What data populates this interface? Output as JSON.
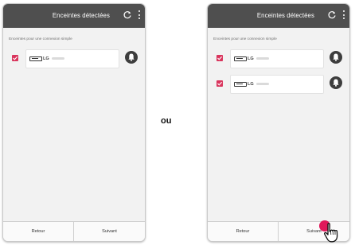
{
  "separator_text": "ou",
  "left_screen": {
    "title": "Enceintes détectées",
    "section_label": "Enceintes pour une connexion simple",
    "devices": [
      {
        "name": "LG",
        "checked": true
      }
    ],
    "back_label": "Retour",
    "next_label": "Suivant"
  },
  "right_screen": {
    "title": "Enceintes détectées",
    "section_label": "Enceintes pour une connexion simple",
    "devices": [
      {
        "name": "LG",
        "checked": true
      },
      {
        "name": "LG",
        "checked": true
      }
    ],
    "back_label": "Retour",
    "next_label": "Suivant"
  },
  "colors": {
    "titlebar": "#4f4f4f",
    "checkbox": "#d9355d",
    "tap_highlight": "#e0185a"
  },
  "icons": [
    "refresh-icon",
    "kebab-menu-icon",
    "checkbox-checked-icon",
    "speaker-icon",
    "bell-icon",
    "hand-pointer-icon"
  ]
}
